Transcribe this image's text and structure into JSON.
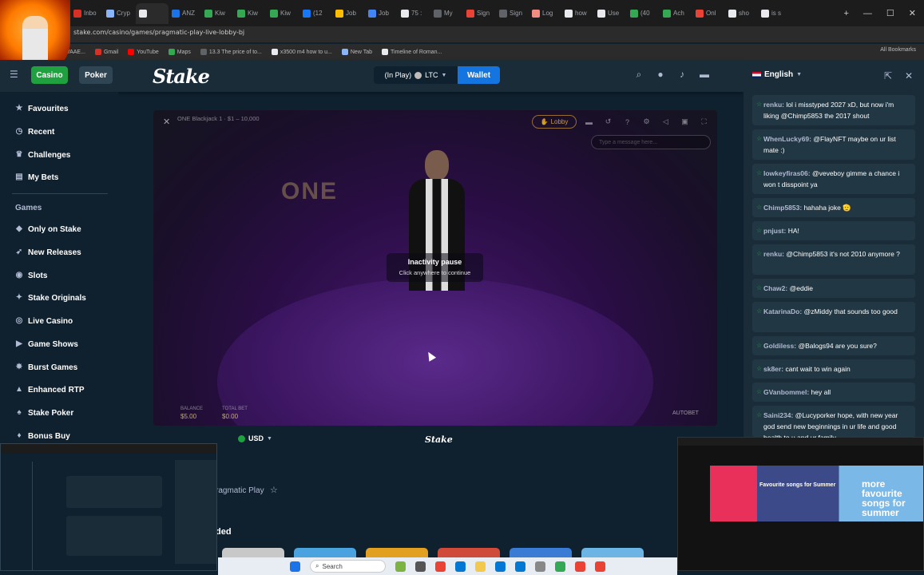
{
  "browser": {
    "tabs": [
      {
        "label": "Inbo",
        "color": "#d93025"
      },
      {
        "label": "Cryp",
        "color": "#8ab4f8"
      },
      {
        "label": "",
        "color": "#e8eaed"
      },
      {
        "label": "ANZ",
        "color": "#1a73e8"
      },
      {
        "label": "Kiw",
        "color": "#34a853"
      },
      {
        "label": "Kiw",
        "color": "#34a853"
      },
      {
        "label": "Kiw",
        "color": "#34a853"
      },
      {
        "label": "(12",
        "color": "#1877f2"
      },
      {
        "label": "Job",
        "color": "#fbbc04"
      },
      {
        "label": "Job",
        "color": "#4285f4"
      },
      {
        "label": "75 :",
        "color": "#e8eaed"
      },
      {
        "label": "My",
        "color": "#5f6368"
      },
      {
        "label": "Sign",
        "color": "#ea4335"
      },
      {
        "label": "Sign",
        "color": "#5f6368"
      },
      {
        "label": "Log",
        "color": "#f28b82"
      },
      {
        "label": "how",
        "color": "#e8eaed"
      },
      {
        "label": "Use",
        "color": "#e8eaed"
      },
      {
        "label": "(40",
        "color": "#34a853"
      },
      {
        "label": "Ach",
        "color": "#34a853"
      },
      {
        "label": "Onl",
        "color": "#ea4335"
      },
      {
        "label": "sho",
        "color": "#e8eaed"
      },
      {
        "label": "is s",
        "color": "#e8eaed"
      }
    ],
    "url": "stake.com/casino/games/pragmatic-play-live-lobby-bj",
    "bookmarks": [
      {
        "label": "IVAAE...",
        "color": "#5f6368"
      },
      {
        "label": "Gmail",
        "color": "#d93025"
      },
      {
        "label": "YouTube",
        "color": "#ff0000"
      },
      {
        "label": "Maps",
        "color": "#34a853"
      },
      {
        "label": "13.3 The price of to...",
        "color": "#5f6368"
      },
      {
        "label": "x3500 m4 how to u...",
        "color": "#e8eaed"
      },
      {
        "label": "New Tab",
        "color": "#8ab4f8"
      },
      {
        "label": "Timeline of Roman...",
        "color": "#e8eaed"
      }
    ],
    "all_bookmarks": "All Bookmarks"
  },
  "header": {
    "casino": "Casino",
    "poker": "Poker",
    "logo": "Stake",
    "balance_label": "(In Play)",
    "balance_currency": "LTC",
    "wallet": "Wallet"
  },
  "sidebar": {
    "items_top": [
      {
        "label": "Favourites",
        "icon": "star-icon",
        "glyph": "★"
      },
      {
        "label": "Recent",
        "icon": "clock-icon",
        "glyph": "◷"
      },
      {
        "label": "Challenges",
        "icon": "trophy-icon",
        "glyph": "♛"
      },
      {
        "label": "My Bets",
        "icon": "document-icon",
        "glyph": "▤"
      }
    ],
    "games_heading": "Games",
    "items_games": [
      {
        "label": "Only on Stake",
        "icon": "stake-icon",
        "glyph": "◆"
      },
      {
        "label": "New Releases",
        "icon": "rocket-icon",
        "glyph": "➶"
      },
      {
        "label": "Slots",
        "icon": "slots-icon",
        "glyph": "◉"
      },
      {
        "label": "Stake Originals",
        "icon": "originals-icon",
        "glyph": "✦"
      },
      {
        "label": "Live Casino",
        "icon": "live-icon",
        "glyph": "◎"
      },
      {
        "label": "Game Shows",
        "icon": "gameshow-icon",
        "glyph": "▶"
      },
      {
        "label": "Burst Games",
        "icon": "burst-icon",
        "glyph": "✸"
      },
      {
        "label": "Enhanced RTP",
        "icon": "rtp-icon",
        "glyph": "▲"
      },
      {
        "label": "Stake Poker",
        "icon": "poker-icon",
        "glyph": "♠"
      },
      {
        "label": "Bonus Buy",
        "icon": "bonus-icon",
        "glyph": "♦"
      }
    ]
  },
  "game": {
    "title": "ONE Blackjack 1 · $1 – 10,000",
    "logo_text": "ONE",
    "lobby": "Lobby",
    "chat_placeholder": "Type a message here...",
    "pause_title": "Inactivity pause",
    "pause_subtitle": "Click anywhere to continue",
    "balance_label": "BALANCE",
    "balance_value": "$5.00",
    "total_bet_label": "TOTAL BET",
    "total_bet_value": "$0.00",
    "autobet": "AUTOBET"
  },
  "below_game": {
    "currency": "USD",
    "stake_mini": "Stake",
    "provider": "ragmatic Play",
    "section_heading": "ded"
  },
  "chat": {
    "language": "English",
    "messages": [
      {
        "user": "renku:",
        "text": "lol i misstyped 2027 xD, but now i'm liking @Chimp5853 the 2017 shout"
      },
      {
        "user": "WhenLucky69:",
        "text": "@FlayNFT maybe on ur list mate :)"
      },
      {
        "user": "lowkeyfiras06:",
        "text": "@veveboy gimme a chance i won t disspoint ya"
      },
      {
        "user": "Chimp5853:",
        "text": "hahaha joke 🫡"
      },
      {
        "user": "pnjust:",
        "text": "HA!"
      },
      {
        "user": "renku:",
        "text": "@Chimp5853 it's not 2010 anymore ?"
      },
      {
        "user": "Chaw2:",
        "text": "@eddie"
      },
      {
        "user": "KatarinaDo:",
        "text": "@zMiddy that sounds too good"
      },
      {
        "user": "Goldiless:",
        "text": "@Balogs94 are you sure?"
      },
      {
        "user": "sk8er:",
        "text": "cant wait to win again"
      },
      {
        "user": "GVanbommel:",
        "text": "hey all"
      },
      {
        "user": "Saini234:",
        "text": "@Lucyporker hope, with new year god send new beginnings in ur life and good health to u and ur family"
      }
    ]
  },
  "taskbar": {
    "search": "Search"
  },
  "thumb_right": {
    "title": "Favourite songs for Summer",
    "promo": "more favourite songs for summer"
  }
}
